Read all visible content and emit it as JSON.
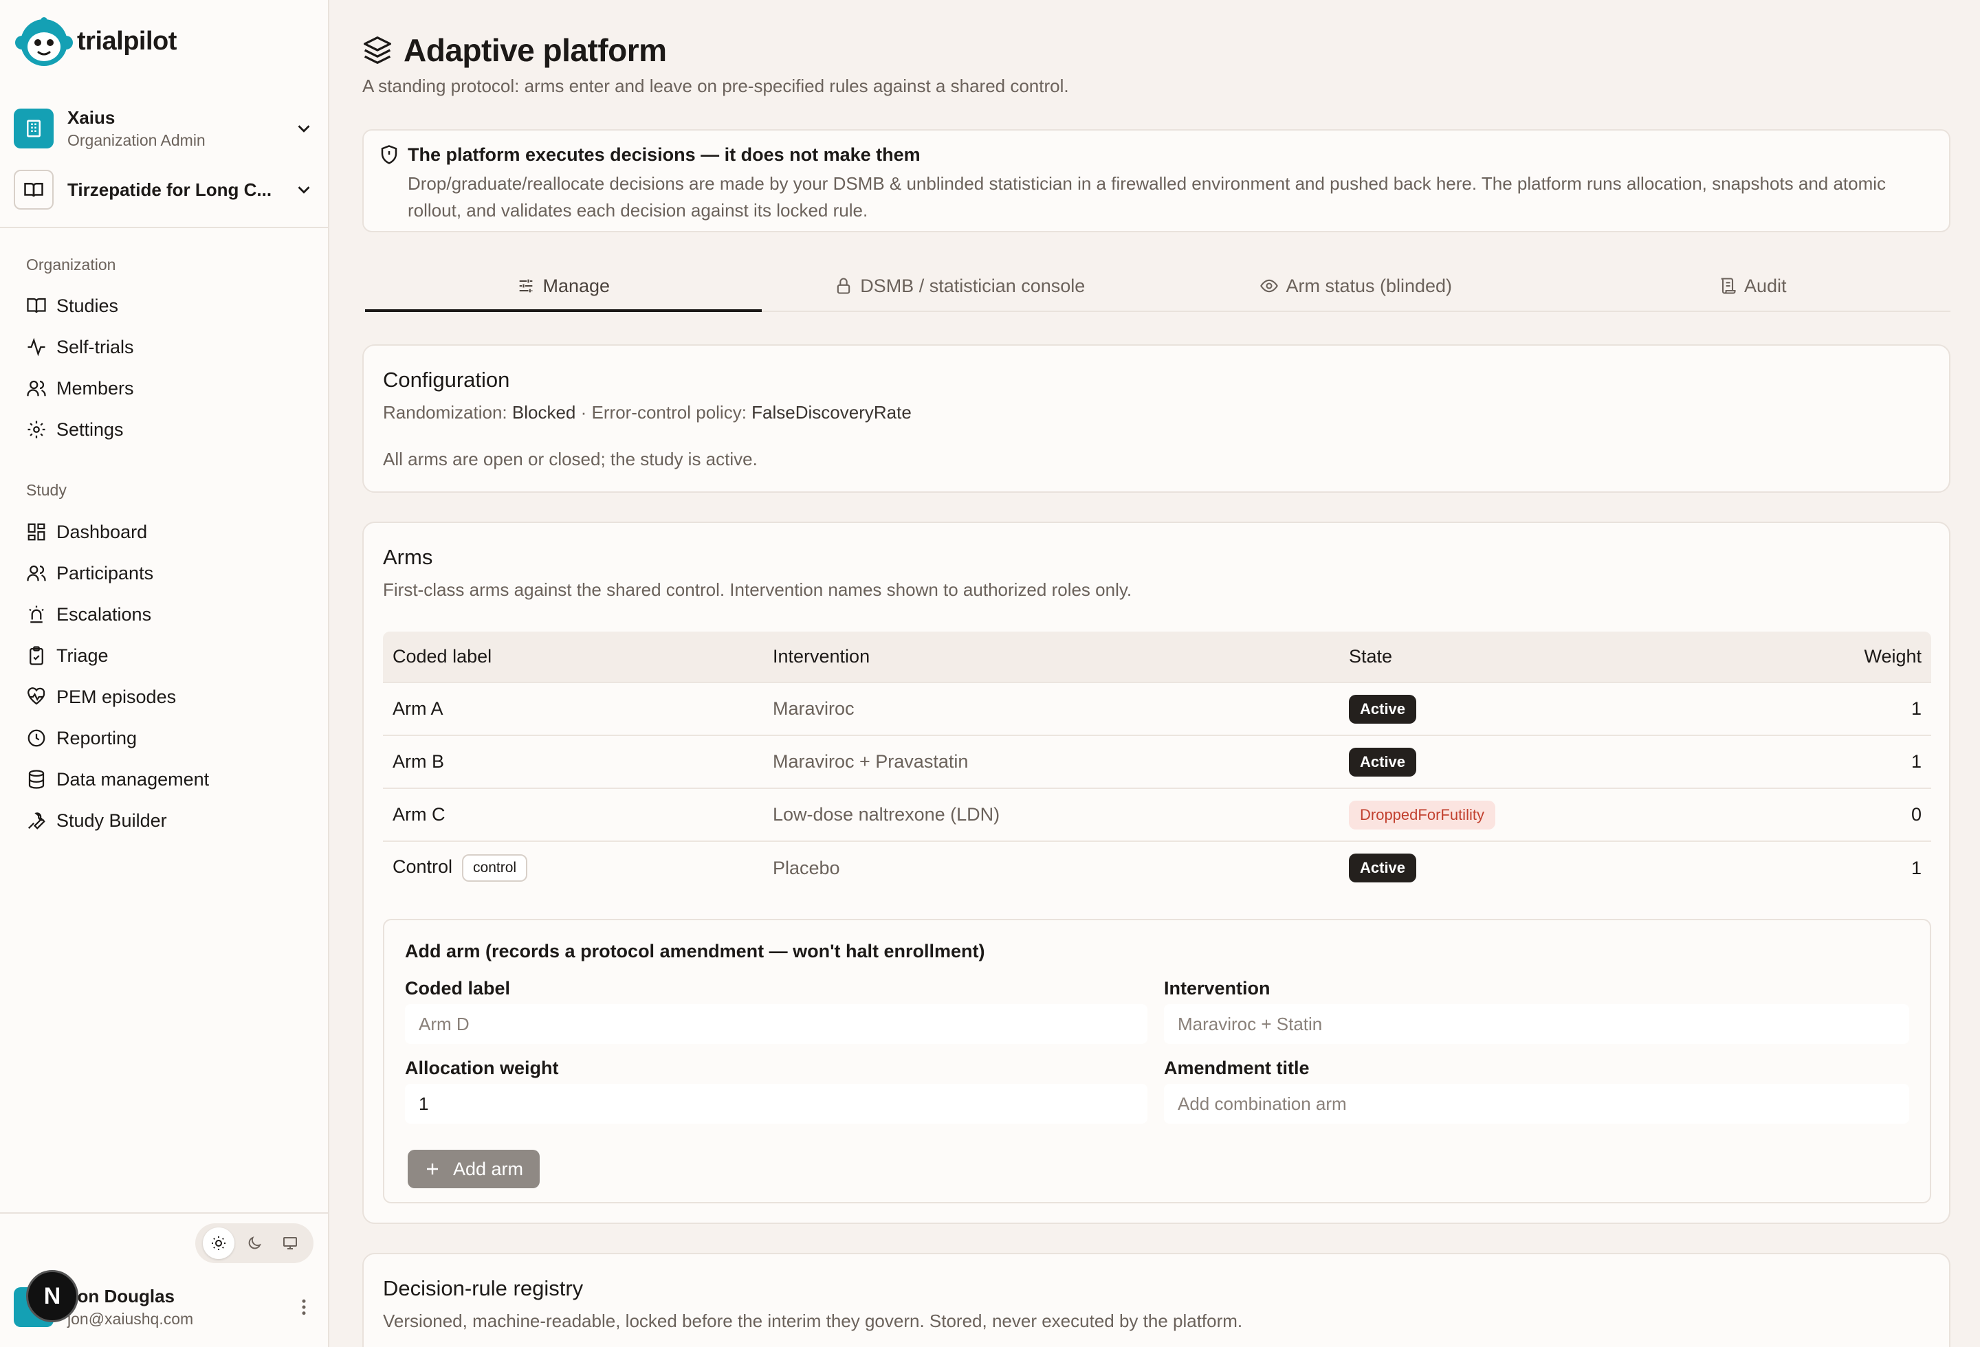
{
  "brand": {
    "name": "trialpilot"
  },
  "org": {
    "name": "Xaius",
    "role": "Organization Admin"
  },
  "study": {
    "name": "Tirzepatide for Long C..."
  },
  "nav": {
    "org_section": "Organization",
    "org_items": [
      "Studies",
      "Self-trials",
      "Members",
      "Settings"
    ],
    "study_section": "Study",
    "study_items": [
      "Dashboard",
      "Participants",
      "Escalations",
      "Triage",
      "PEM episodes",
      "Reporting",
      "Data management",
      "Study Builder"
    ]
  },
  "user": {
    "name": "Jon Douglas",
    "email": "jon@xaiushq.com",
    "badge": "N"
  },
  "page": {
    "title": "Adaptive platform",
    "subtitle": "A standing protocol: arms enter and leave on pre-specified rules against a shared control."
  },
  "notice": {
    "title": "The platform executes decisions — it does not make them",
    "body": "Drop/graduate/reallocate decisions are made by your DSMB & unblinded statistician in a firewalled environment and pushed back here. The platform runs allocation, snapshots and atomic rollout, and validates each decision against its locked rule."
  },
  "tabs": [
    {
      "label": "Manage",
      "icon": "sliders-icon",
      "active": true
    },
    {
      "label": "DSMB / statistician console",
      "icon": "lock-icon",
      "active": false
    },
    {
      "label": "Arm status (blinded)",
      "icon": "eye-icon",
      "active": false
    },
    {
      "label": "Audit",
      "icon": "scroll-icon",
      "active": false
    }
  ],
  "configuration": {
    "title": "Configuration",
    "randomization_label": "Randomization:",
    "randomization_value": "Blocked",
    "separator": "·",
    "policy_label": "Error-control policy:",
    "policy_value": "FalseDiscoveryRate",
    "status": "All arms are open or closed; the study is active."
  },
  "arms": {
    "title": "Arms",
    "subtitle": "First-class arms against the shared control. Intervention names shown to authorized roles only.",
    "columns": [
      "Coded label",
      "Intervention",
      "State",
      "Weight"
    ],
    "rows": [
      {
        "label": "Arm A",
        "intervention": "Maraviroc",
        "state": "Active",
        "weight": "1"
      },
      {
        "label": "Arm B",
        "intervention": "Maraviroc + Pravastatin",
        "state": "Active",
        "weight": "1"
      },
      {
        "label": "Arm C",
        "intervention": "Low-dose naltrexone (LDN)",
        "state": "DroppedForFutility",
        "weight": "0"
      },
      {
        "label": "Control",
        "tag": "control",
        "intervention": "Placebo",
        "state": "Active",
        "weight": "1"
      }
    ]
  },
  "add_arm": {
    "title": "Add arm (records a protocol amendment — won't halt enrollment)",
    "coded_label": {
      "label": "Coded label",
      "placeholder": "Arm D"
    },
    "intervention": {
      "label": "Intervention",
      "placeholder": "Maraviroc + Statin"
    },
    "weight": {
      "label": "Allocation weight",
      "value": "1"
    },
    "amendment": {
      "label": "Amendment title",
      "placeholder": "Add combination arm"
    },
    "button": "Add arm"
  },
  "registry": {
    "title": "Decision-rule registry",
    "subtitle": "Versioned, machine-readable, locked before the interim they govern. Stored, never executed by the platform."
  },
  "colors": {
    "accent": "#14a0b4",
    "background": "#f7f2ee",
    "active_pill": "#24201d",
    "dropped_pill_bg": "#fbe4e0",
    "dropped_pill_text": "#c2412f"
  }
}
